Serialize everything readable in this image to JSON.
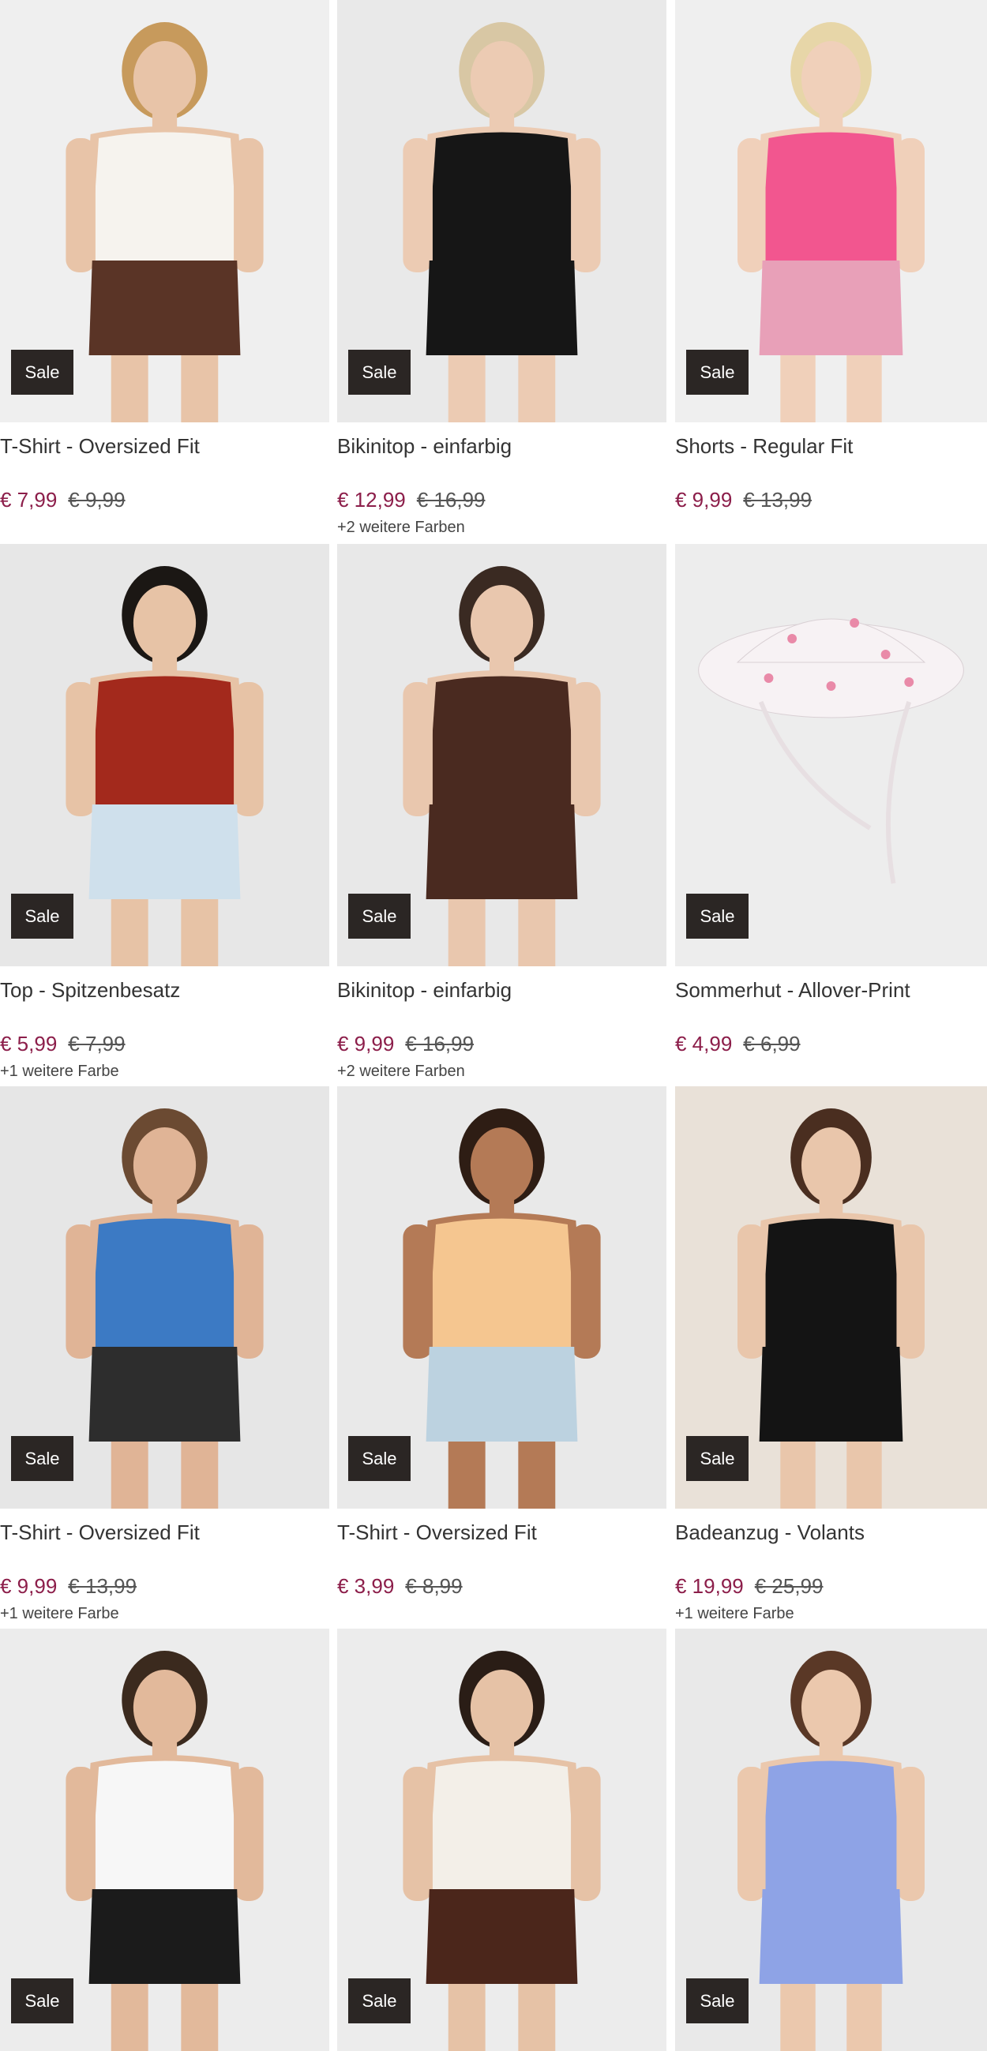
{
  "products": [
    {
      "title": "T-Shirt - Oversized Fit",
      "badge": "Sale",
      "price": "€ 7,99",
      "old_price": "€ 9,99",
      "colors": "",
      "bg": "#efefef",
      "garment": "#f6f3ee",
      "garment2": "#5a3426",
      "skin": "#e8c4a8",
      "hair": "#c79a5c"
    },
    {
      "title": "Bikinitop - einfarbig",
      "badge": "Sale",
      "price": "€ 12,99",
      "old_price": "€ 16,99",
      "colors": "+2 weitere Farben",
      "bg": "#e9e9e9",
      "garment": "#161616",
      "garment2": "#161616",
      "skin": "#eccbb3",
      "hair": "#d8c7a4"
    },
    {
      "title": "Shorts - Regular Fit",
      "badge": "Sale",
      "price": "€ 9,99",
      "old_price": "€ 13,99",
      "colors": "",
      "bg": "#efefef",
      "garment": "#f2568f",
      "garment2": "#e8a0b8",
      "skin": "#f0d0ba",
      "hair": "#e7d6a8"
    },
    {
      "title": "Top - Spitzenbesatz",
      "badge": "Sale",
      "price": "€ 5,99",
      "old_price": "€ 7,99",
      "colors": "+1 weitere Farbe",
      "bg": "#e7e7e7",
      "garment": "#a3291c",
      "garment2": "#cfe0ec",
      "skin": "#e7c3a6",
      "hair": "#1b1714"
    },
    {
      "title": "Bikinitop - einfarbig",
      "badge": "Sale",
      "price": "€ 9,99",
      "old_price": "€ 16,99",
      "colors": "+2 weitere Farben",
      "bg": "#e8e8e8",
      "garment": "#4a2a20",
      "garment2": "#4a2a20",
      "skin": "#e9c7ae",
      "hair": "#3a2a22"
    },
    {
      "title": "Sommerhut - Allover-Print",
      "badge": "Sale",
      "price": "€ 4,99",
      "old_price": "€ 6,99",
      "colors": "",
      "bg": "#ededed",
      "garment": "#f7f2f4",
      "garment2": "#e98aa8",
      "skin": "#ededed",
      "hair": "#ededed"
    },
    {
      "title": "T-Shirt - Oversized Fit",
      "badge": "Sale",
      "price": "€ 9,99",
      "old_price": "€ 13,99",
      "colors": "+1 weitere Farbe",
      "bg": "#e6e6e6",
      "garment": "#3c7ac4",
      "garment2": "#2d2d2d",
      "skin": "#e0b496",
      "hair": "#6b4a32"
    },
    {
      "title": "T-Shirt - Oversized Fit",
      "badge": "Sale",
      "price": "€ 3,99",
      "old_price": "€ 8,99",
      "colors": "",
      "bg": "#e9e9e9",
      "garment": "#f5c690",
      "garment2": "#bcd2e0",
      "skin": "#b47a56",
      "hair": "#2e1d14"
    },
    {
      "title": "Badeanzug - Volants",
      "badge": "Sale",
      "price": "€ 19,99",
      "old_price": "€ 25,99",
      "colors": "+1 weitere Farbe",
      "bg": "#e9e1d8",
      "garment": "#141414",
      "garment2": "#141414",
      "skin": "#e9c6ab",
      "hair": "#4a2e20"
    },
    {
      "title": "",
      "badge": "Sale",
      "price": "",
      "old_price": "",
      "colors": "",
      "bg": "#ececec",
      "garment": "#f7f7f7",
      "garment2": "#1b1b1b",
      "skin": "#e2b99b",
      "hair": "#3b2a1e"
    },
    {
      "title": "",
      "badge": "Sale",
      "price": "",
      "old_price": "",
      "colors": "",
      "bg": "#ececec",
      "garment": "#f3efe8",
      "garment2": "#4b261b",
      "skin": "#e6c2a6",
      "hair": "#2a1d16"
    },
    {
      "title": "",
      "badge": "Sale",
      "price": "",
      "old_price": "",
      "colors": "",
      "bg": "#e9e9e9",
      "garment": "#8ea3e6",
      "garment2": "#8ea3e6",
      "skin": "#ebc8ad",
      "hair": "#5a3826"
    }
  ]
}
